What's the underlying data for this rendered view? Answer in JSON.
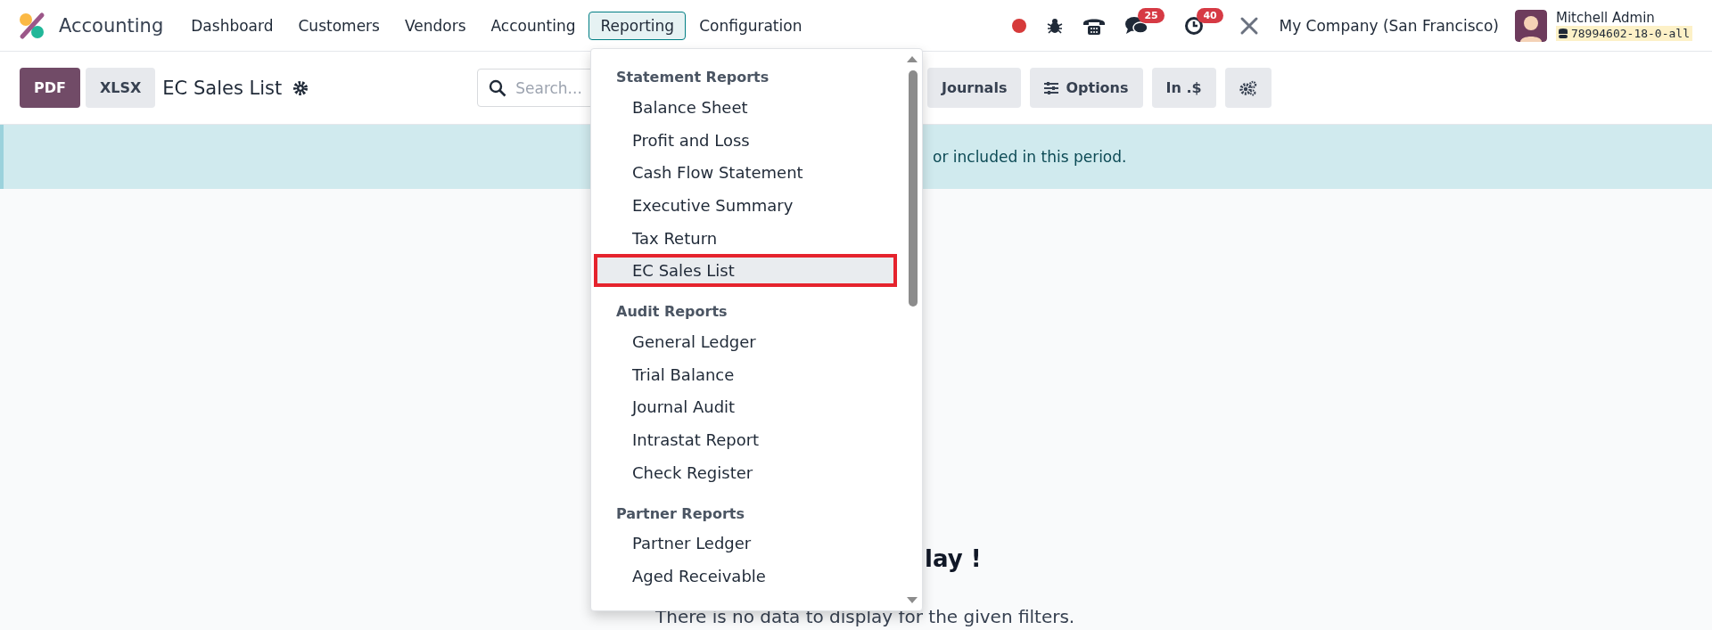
{
  "navbar": {
    "app_name": "Accounting",
    "menu": [
      {
        "label": "Dashboard",
        "selected": false
      },
      {
        "label": "Customers",
        "selected": false
      },
      {
        "label": "Vendors",
        "selected": false
      },
      {
        "label": "Accounting",
        "selected": false
      },
      {
        "label": "Reporting",
        "selected": true
      },
      {
        "label": "Configuration",
        "selected": false
      }
    ],
    "messages_badge": "25",
    "activities_badge": "40",
    "company": "My Company (San Francisco)",
    "user": "Mitchell Admin",
    "database": "78994602-18-0-all"
  },
  "control_bar": {
    "buttons": [
      {
        "label": "PDF",
        "kind": "primary"
      },
      {
        "label": "XLSX",
        "kind": "secondary"
      }
    ],
    "title": "EC Sales List",
    "search": {
      "placeholder": "Search..."
    },
    "filters": [
      {
        "label": "Journals",
        "kind": "text"
      },
      {
        "label": "Options",
        "kind": "sliders"
      },
      {
        "label": "In .$",
        "kind": "text"
      },
      {
        "kind": "gears"
      }
    ]
  },
  "banner": {
    "text": "or included in this period."
  },
  "empty_state": {
    "heading": "lay !",
    "text": "There is no data to display for the given filters."
  },
  "dropdown": {
    "groups": [
      {
        "heading": "Statement Reports",
        "items": [
          {
            "label": "Balance Sheet",
            "selected": false
          },
          {
            "label": "Profit and Loss",
            "selected": false
          },
          {
            "label": "Cash Flow Statement",
            "selected": false
          },
          {
            "label": "Executive Summary",
            "selected": false
          },
          {
            "label": "Tax Return",
            "selected": false
          },
          {
            "label": "EC Sales List",
            "selected": true
          }
        ]
      },
      {
        "heading": "Audit Reports",
        "items": [
          {
            "label": "General Ledger",
            "selected": false
          },
          {
            "label": "Trial Balance",
            "selected": false
          },
          {
            "label": "Journal Audit",
            "selected": false
          },
          {
            "label": "Intrastat Report",
            "selected": false
          },
          {
            "label": "Check Register",
            "selected": false
          }
        ]
      },
      {
        "heading": "Partner Reports",
        "items": [
          {
            "label": "Partner Ledger",
            "selected": false
          },
          {
            "label": "Aged Receivable",
            "selected": false
          }
        ]
      }
    ]
  }
}
